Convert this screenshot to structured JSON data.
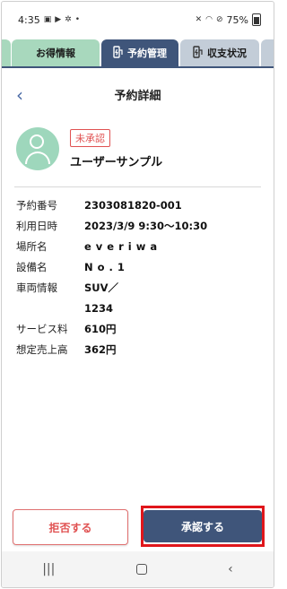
{
  "statusbar": {
    "time": "4:35",
    "icons_left": [
      "image-icon",
      "play-icon",
      "gear-icon",
      "dot-icon"
    ],
    "battery": "75%"
  },
  "tabs": [
    {
      "label": "お得情報",
      "active": false
    },
    {
      "label": "予約管理",
      "active": true
    },
    {
      "label": "収支状況",
      "active": false
    }
  ],
  "header": {
    "back_glyph": "‹",
    "title": "予約詳細"
  },
  "profile": {
    "badge": "未承認",
    "name": "ユーザーサンプル"
  },
  "details": [
    {
      "label": "予約番号",
      "value": "2303081820-001"
    },
    {
      "label": "利用日時",
      "value": "2023/3/9 9:30〜10:30"
    },
    {
      "label": "場所名",
      "value": "everiwa"
    },
    {
      "label": "設備名",
      "value": "No.1"
    },
    {
      "label": "車両情報",
      "value": "SUV／"
    },
    {
      "label": "",
      "value": "1234"
    },
    {
      "label": "サービス料",
      "value": "610円"
    },
    {
      "label": "想定売上高",
      "value": "362円"
    }
  ],
  "actions": {
    "reject": "拒否する",
    "approve": "承認する"
  },
  "navbar": {
    "recent": "|||",
    "back": "‹"
  },
  "colors": {
    "primary": "#3f557a",
    "green_tab": "#a8d8bd",
    "gray_tab": "#c3cdd8",
    "danger": "#e05151",
    "highlight": "#e0161b",
    "avatar": "#9ed7bc"
  }
}
